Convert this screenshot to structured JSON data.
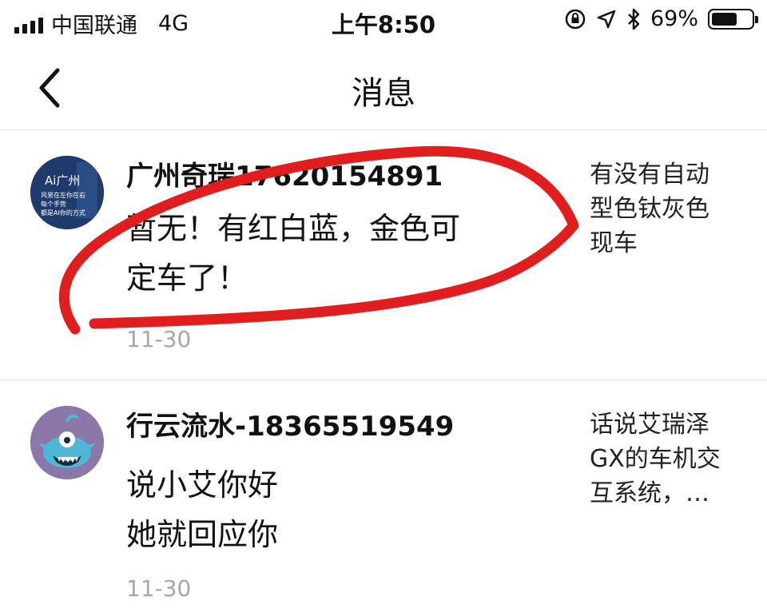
{
  "status_bar": {
    "carrier": "中国联通",
    "network": "4G",
    "time": "上午8:50",
    "battery": "69%",
    "battery_level": 0.69
  },
  "nav": {
    "title": "消息"
  },
  "messages": [
    {
      "sender": "广州奇瑞17620154891",
      "text_lines": [
        "暂无！有红白蓝，金色可",
        "定车了！"
      ],
      "date": "11-30",
      "preview_lines": [
        "有没有自动",
        "型色钛灰色",
        "现车"
      ],
      "avatar_text": [
        "Ai广州",
        "风景在左你在右",
        "每个手势",
        "都是AI你的方式"
      ]
    },
    {
      "sender": "行云流水-18365519549",
      "text_lines": [
        "说小艾你好",
        "她就回应你"
      ],
      "date": "11-30",
      "preview_lines": [
        "话说艾瑞泽",
        "GX的车机交",
        "互系统，…"
      ]
    }
  ],
  "colors": {
    "annotation": "#e01e1e",
    "date_text": "#a7a7a7",
    "divider": "#e6e6e6"
  }
}
